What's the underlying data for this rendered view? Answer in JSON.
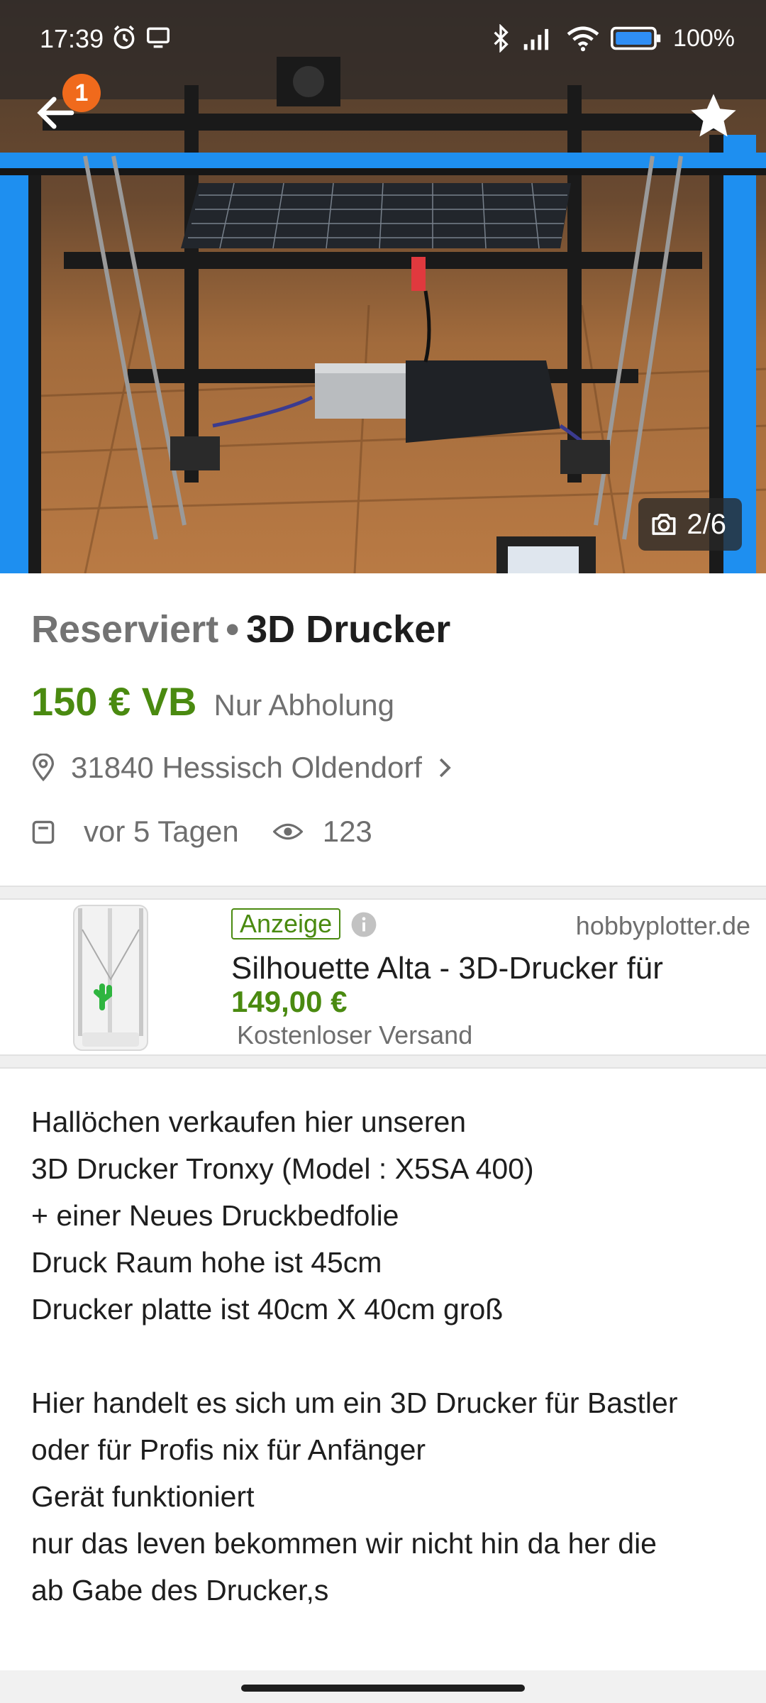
{
  "status_bar": {
    "time": "17:39",
    "battery": "100%",
    "left_icons": [
      "alarm-icon",
      "screen-cast-icon"
    ],
    "right_icons": [
      "bluetooth-icon",
      "signal-icon",
      "wifi-icon",
      "battery-icon"
    ]
  },
  "header": {
    "notification_count": "1",
    "back_icon": "arrow-left-icon",
    "favorite_icon": "star-icon"
  },
  "gallery": {
    "counter": "2/6",
    "counter_icon": "camera-icon"
  },
  "listing": {
    "status": "Reserviert",
    "separator": "•",
    "title": "3D Drucker",
    "price": "150 € VB",
    "delivery": "Nur Abholung",
    "location": "31840 Hessisch Oldendorf",
    "posted": "vor 5 Tagen",
    "views": "123"
  },
  "ad": {
    "badge": "Anzeige",
    "domain": "hobbyplotter.de",
    "title": "Silhouette Alta - 3D-Drucker für",
    "price": "149,00 €",
    "shipping": "Kostenloser Versand"
  },
  "description": {
    "lines": [
      "Hallöchen verkaufen hier unseren",
      "3D Drucker Tronxy (Model : X5SA 400)",
      "+ einer Neues Druckbedfolie",
      "Druck Raum hohe ist 45cm",
      "Drucker platte ist 40cm X 40cm groß",
      "",
      "Hier handelt es sich um ein 3D Drucker für Bastler",
      "oder für Profis nix für Anfänger",
      "Gerät funktioniert",
      "nur das leven bekommen wir nicht hin da her die",
      "ab Gabe des Drucker,s"
    ]
  },
  "colors": {
    "price_green": "#4a8a10",
    "badge_orange": "#f06a1c",
    "frame_blue": "#1e8ff0"
  }
}
